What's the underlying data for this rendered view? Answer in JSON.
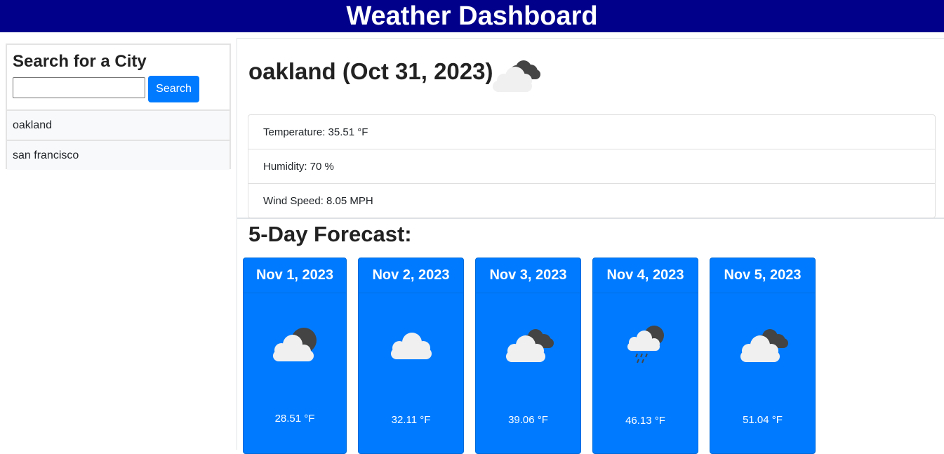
{
  "header": {
    "title": "Weather Dashboard"
  },
  "sidebar": {
    "title": "Search for a City",
    "search_value": "",
    "search_button": "Search",
    "history": [
      "oakland",
      "san francisco"
    ]
  },
  "current": {
    "title": "oakland (Oct 31, 2023)",
    "icon": "sun-behind-cloud-icon",
    "temperature": "Temperature: 35.51 °F",
    "humidity": "Humidity: 70 %",
    "wind": "Wind Speed: 8.05 MPH"
  },
  "forecast": {
    "title": "5-Day Forecast:",
    "days": [
      {
        "date": "Nov 1, 2023",
        "temp": "28.51 °F",
        "icon": "partly-cloudy-icon"
      },
      {
        "date": "Nov 2, 2023",
        "temp": "32.11 °F",
        "icon": "cloud-icon"
      },
      {
        "date": "Nov 3, 2023",
        "temp": "39.06 °F",
        "icon": "broken-clouds-icon"
      },
      {
        "date": "Nov 4, 2023",
        "temp": "46.13 °F",
        "icon": "rain-cloud-icon"
      },
      {
        "date": "Nov 5, 2023",
        "temp": "51.04 °F",
        "icon": "broken-clouds-icon"
      }
    ]
  },
  "colors": {
    "header_bg": "#00008b",
    "accent": "#007bff",
    "dark_cloud": "#444444",
    "light_cloud": "#f0f0f0"
  }
}
